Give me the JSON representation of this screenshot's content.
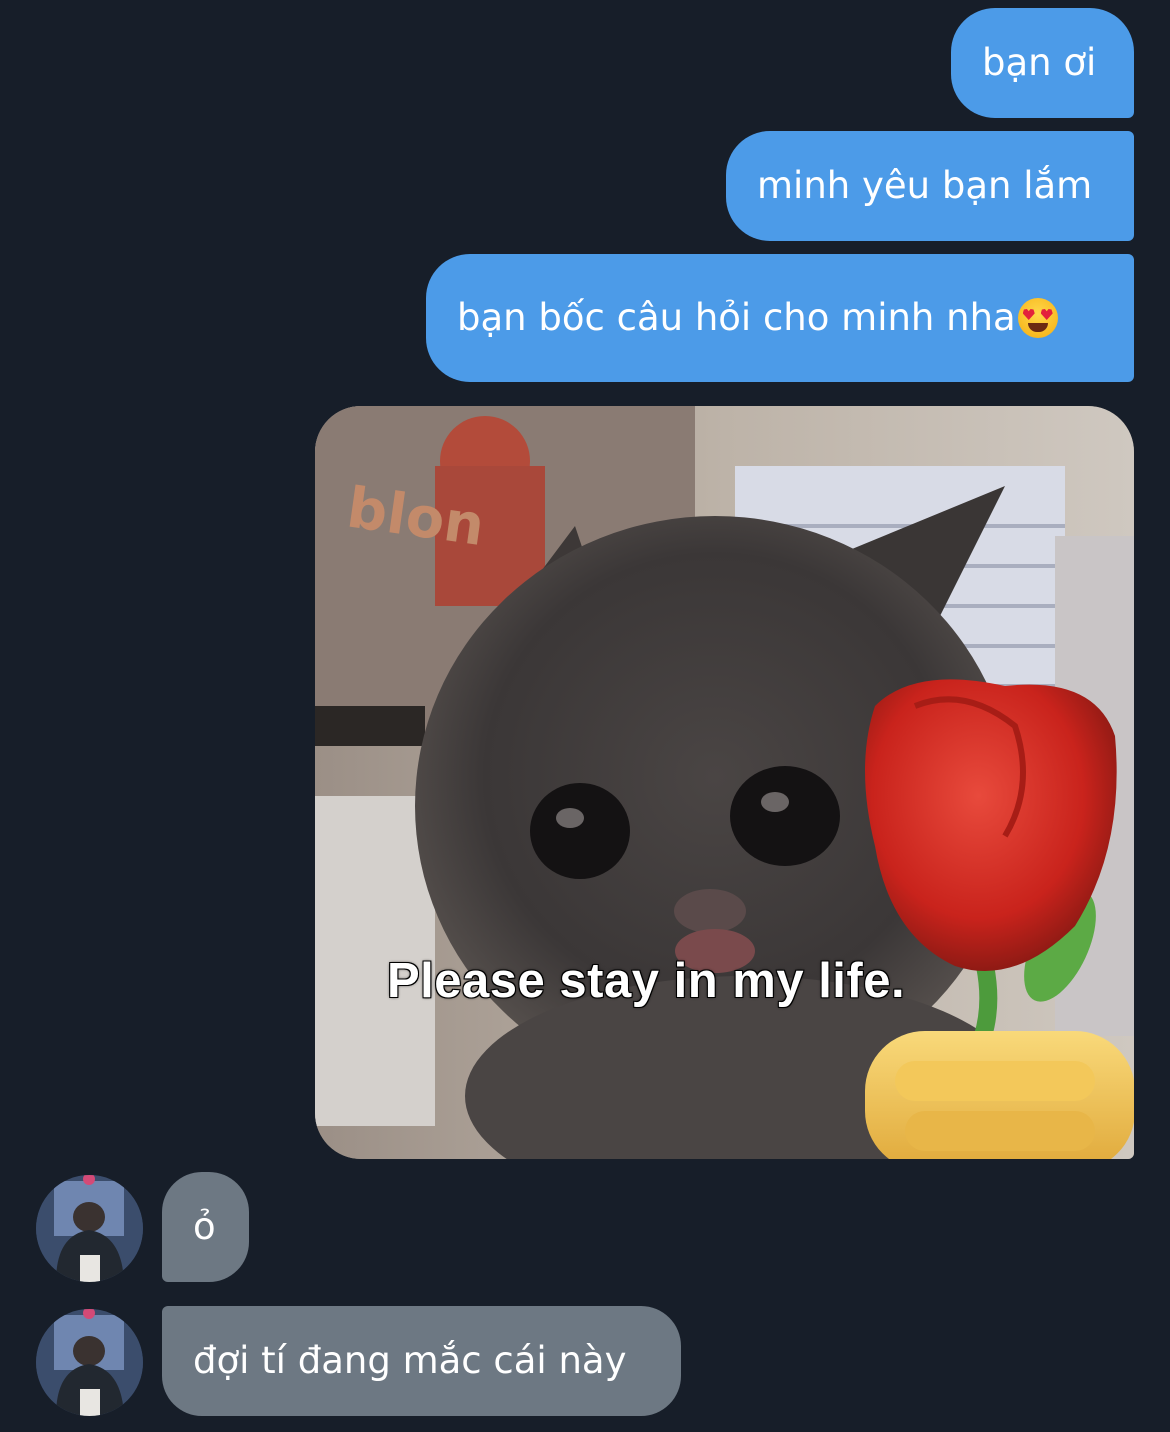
{
  "conversation": {
    "outgoing": [
      {
        "text": "bạn ơi"
      },
      {
        "text": "minh yêu bạn lắm"
      },
      {
        "text": "bạn bốc câu hỏi cho minh nha",
        "emoji": "smiling-face-with-heart-eyes"
      }
    ],
    "image_message": {
      "caption": "Please stay in my life.",
      "poster_text": "blon"
    },
    "incoming": [
      {
        "text": "ỏ"
      },
      {
        "text": "đợi tí đang mắc cái này"
      }
    ]
  },
  "colors": {
    "background": "#171e29",
    "outgoing_bubble": "#4c9be8",
    "incoming_bubble": "#6d7883",
    "text": "#ffffff"
  }
}
